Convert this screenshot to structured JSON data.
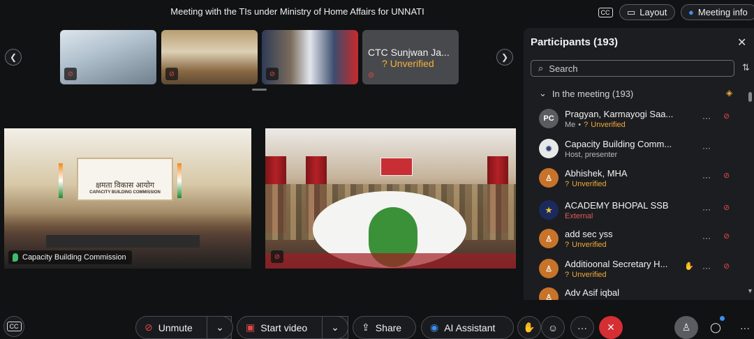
{
  "header": {
    "title": "Meeting with the TIs under Ministry of Home Affairs for UNNATI",
    "cc_label": "CC",
    "layout_label": "Layout",
    "meeting_info_label": "Meeting info"
  },
  "filmstrip": {
    "prev_icon": "chevron-left-icon",
    "next_icon": "chevron-right-icon",
    "tiles": [
      {
        "name": "",
        "muted": true
      },
      {
        "name": "",
        "muted": true
      },
      {
        "name": "",
        "muted": true
      },
      {
        "name": "CTC Sunjwan Ja...",
        "status": "Unverified",
        "muted": true
      }
    ]
  },
  "videos": [
    {
      "label": "Capacity Building Commission",
      "banner_text": "क्षमता विकास आयोग",
      "banner_subtext": "CAPACITY BUILDING COMMISSION"
    },
    {
      "label": "",
      "muted": true
    }
  ],
  "participants": {
    "title": "Participants (193)",
    "search_placeholder": "Search",
    "group_label": "In the meeting (193)",
    "list": [
      {
        "initials": "PC",
        "name": "Pragyan, Karmayogi Saa...",
        "sub": "Me",
        "status": "Unverified"
      },
      {
        "initials": "",
        "name": "Capacity Building Comm...",
        "sub": "Host, presenter",
        "status": ""
      },
      {
        "initials": "",
        "name": "Abhishek, MHA",
        "sub": "",
        "status": "Unverified"
      },
      {
        "initials": "",
        "name": "ACADEMY BHOPAL SSB",
        "sub": "External",
        "status": ""
      },
      {
        "initials": "",
        "name": "add sec yss",
        "sub": "",
        "status": "Unverified"
      },
      {
        "initials": "",
        "name": "Additioonal Secretary H...",
        "sub": "",
        "status": "Unverified"
      },
      {
        "initials": "",
        "name": "Adv Asif iqbal",
        "sub": "",
        "status": ""
      }
    ]
  },
  "toolbar": {
    "cc_label": "CC",
    "unmute_label": "Unmute",
    "start_video_label": "Start video",
    "share_label": "Share",
    "ai_label": "AI Assistant"
  },
  "colors": {
    "background": "#111214",
    "panel": "#1c1d20",
    "unverified": "#f0a93a",
    "muted_red": "#e04848",
    "end_call": "#d52e33",
    "chat_badge": "#3f8ef0"
  }
}
